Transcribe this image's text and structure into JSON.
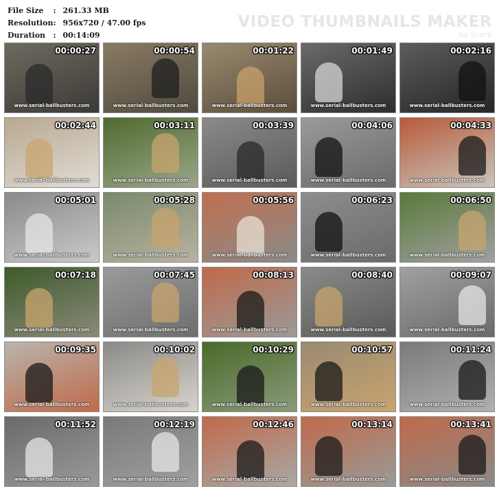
{
  "info": {
    "file_size_label": "File Size",
    "file_size_value": "261.33 MB",
    "resolution_label": "Resolution",
    "resolution_value": "956x720 / 47.00 fps",
    "duration_label": "Duration",
    "duration_value": "00:14:09",
    "colon": ":"
  },
  "brand": {
    "title": "VIDEO THUMBNAILS MAKER",
    "subtitle": "by Scorp"
  },
  "watermark": "www.serial-ballbusters.com",
  "thumbnails": [
    {
      "time": "00:00:27",
      "bg": [
        "#6e6a60",
        "#3c3a36"
      ],
      "fig": "#2a2a2a"
    },
    {
      "time": "00:00:54",
      "bg": [
        "#8a7b62",
        "#4f4a40"
      ],
      "fig": "#1f1f1f"
    },
    {
      "time": "00:01:22",
      "bg": [
        "#9a8a6e",
        "#5a4e3c"
      ],
      "fig": "#c9a06a"
    },
    {
      "time": "00:01:49",
      "bg": [
        "#6a6a6a",
        "#2e2e2e"
      ],
      "fig": "#d6d6d6"
    },
    {
      "time": "00:02:16",
      "bg": [
        "#5c5c5c",
        "#262626"
      ],
      "fig": "#111111"
    },
    {
      "time": "00:02:44",
      "bg": [
        "#b8a890",
        "#e0dcd6"
      ],
      "fig": "#c8a46e"
    },
    {
      "time": "00:03:11",
      "bg": [
        "#4f6b2e",
        "#9aa68a"
      ],
      "fig": "#c8a46e"
    },
    {
      "time": "00:03:39",
      "bg": [
        "#8a8a88",
        "#5a5a58"
      ],
      "fig": "#2a2a2a"
    },
    {
      "time": "00:04:06",
      "bg": [
        "#9a9a9a",
        "#6a6a6a"
      ],
      "fig": "#111111"
    },
    {
      "time": "00:04:33",
      "bg": [
        "#b85a3a",
        "#c9c5bd"
      ],
      "fig": "#1a1a1a"
    },
    {
      "time": "00:05:01",
      "bg": [
        "#8a8a8a",
        "#c9c9c9"
      ],
      "fig": "#e6e6e6"
    },
    {
      "time": "00:05:28",
      "bg": [
        "#7a8a6a",
        "#b9b2a2"
      ],
      "fig": "#c8a46e"
    },
    {
      "time": "00:05:56",
      "bg": [
        "#c07050",
        "#8a8a88"
      ],
      "fig": "#e8e2d4"
    },
    {
      "time": "00:06:23",
      "bg": [
        "#8e8e8e",
        "#6a6a6a"
      ],
      "fig": "#111111"
    },
    {
      "time": "00:06:50",
      "bg": [
        "#5a7a3a",
        "#a0a0a0"
      ],
      "fig": "#c8a46e"
    },
    {
      "time": "00:07:18",
      "bg": [
        "#3e5a2a",
        "#8a8a7a"
      ],
      "fig": "#c8a46e"
    },
    {
      "time": "00:07:45",
      "bg": [
        "#9a9a9a",
        "#6e6e6e"
      ],
      "fig": "#c8a46e"
    },
    {
      "time": "00:08:13",
      "bg": [
        "#c06a4a",
        "#9a9a98"
      ],
      "fig": "#1a1a1a"
    },
    {
      "time": "00:08:40",
      "bg": [
        "#8a8a88",
        "#5a5a58"
      ],
      "fig": "#c8a46e"
    },
    {
      "time": "00:09:07",
      "bg": [
        "#a0a0a0",
        "#6a6a6a"
      ],
      "fig": "#e6e6e6"
    },
    {
      "time": "00:09:35",
      "bg": [
        "#b8b4ac",
        "#c06a4a"
      ],
      "fig": "#1a1a1a"
    },
    {
      "time": "00:10:02",
      "bg": [
        "#8a8a88",
        "#d8d4cc"
      ],
      "fig": "#c8a46e"
    },
    {
      "time": "00:10:29",
      "bg": [
        "#4a6a2a",
        "#8a9a7a"
      ],
      "fig": "#1a1a1a"
    },
    {
      "time": "00:10:57",
      "bg": [
        "#9a8a70",
        "#c8a46e"
      ],
      "fig": "#1a1a1a"
    },
    {
      "time": "00:11:24",
      "bg": [
        "#7a7a7a",
        "#b0b0ae"
      ],
      "fig": "#1a1a1a"
    },
    {
      "time": "00:11:52",
      "bg": [
        "#6a6a6a",
        "#9a9a9a"
      ],
      "fig": "#e6e6e6"
    },
    {
      "time": "00:12:19",
      "bg": [
        "#7a7a7a",
        "#a0a0a0"
      ],
      "fig": "#e6e6e6"
    },
    {
      "time": "00:12:46",
      "bg": [
        "#c06a4a",
        "#a8a8a6"
      ],
      "fig": "#1a1a1a"
    },
    {
      "time": "00:13:14",
      "bg": [
        "#c06a4a",
        "#9a9a98"
      ],
      "fig": "#1a1a1a"
    },
    {
      "time": "00:13:41",
      "bg": [
        "#c06a4a",
        "#8a8a88"
      ],
      "fig": "#1a1a1a"
    }
  ]
}
